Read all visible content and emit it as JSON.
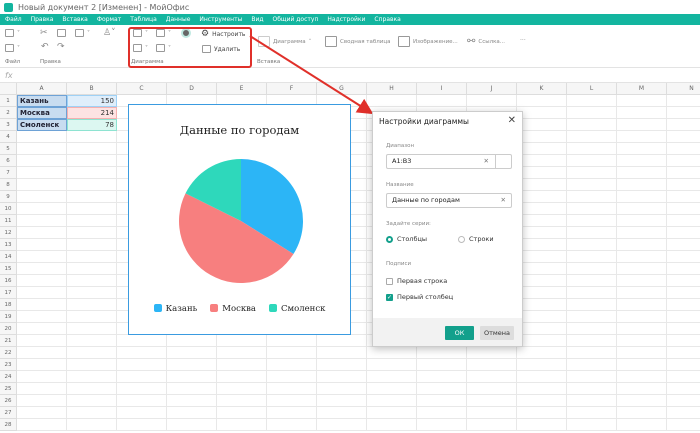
{
  "window": {
    "title": "Новый документ 2 [Изменен] - МойОфис"
  },
  "menu": [
    "Файл",
    "Правка",
    "Вставка",
    "Формат",
    "Таблица",
    "Данные",
    "Инструменты",
    "Вид",
    "Общий доступ",
    "Надстройки",
    "Справка"
  ],
  "toolbar": {
    "groups": {
      "file": "Файл",
      "edit": "Правка",
      "chart": "Диаграмма",
      "insert": "Вставка"
    },
    "configure": "Настроить",
    "delete": "Удалить",
    "diagram": "Диаграмма",
    "pivot": "Сводная таблица",
    "image": "Изображение...",
    "link": "Ссылка...",
    "more": "···"
  },
  "formula": {
    "fx": "fx"
  },
  "columns": [
    "A",
    "B",
    "C",
    "D",
    "E",
    "F",
    "G",
    "H",
    "I",
    "J",
    "K",
    "L",
    "M",
    "N"
  ],
  "rows": [
    "1",
    "2",
    "3",
    "4",
    "5",
    "6",
    "7",
    "8",
    "9",
    "10",
    "11",
    "12",
    "13",
    "14",
    "15",
    "16",
    "17",
    "18",
    "19",
    "20",
    "21",
    "22",
    "23",
    "24",
    "25",
    "26",
    "27",
    "28"
  ],
  "cells": [
    {
      "a": "Казань",
      "b": "150"
    },
    {
      "a": "Москва",
      "b": "214"
    },
    {
      "a": "Смоленск",
      "b": "78"
    }
  ],
  "colors": {
    "kazan": "#2cb5f6",
    "moscow": "#f77f7f",
    "smolensk": "#2ed8bb",
    "accent": "#13b59f"
  },
  "chart_data": {
    "type": "pie",
    "title": "Данные по городам",
    "categories": [
      "Казань",
      "Москва",
      "Смоленск"
    ],
    "values": [
      150,
      214,
      78
    ],
    "legend": "bottom"
  },
  "dialog": {
    "title": "Настройки диаграммы",
    "range_label": "Диапазон",
    "range_value": "A1:B3",
    "name_label": "Название",
    "name_value": "Данные по городам",
    "series_label": "Задайте серии:",
    "series_cols": "Столбцы",
    "series_rows": "Строки",
    "captions_label": "Подписи",
    "first_row": "Первая строка",
    "first_col": "Первый столбец",
    "ok": "ОК",
    "cancel": "Отмена"
  }
}
